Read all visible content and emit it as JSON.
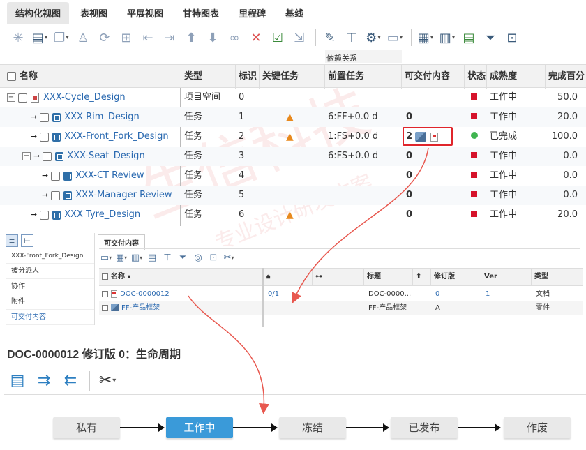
{
  "tabs": [
    {
      "label": "结构化视图",
      "active": true
    },
    {
      "label": "表视图"
    },
    {
      "label": "平展视图"
    },
    {
      "label": "甘特图表"
    },
    {
      "label": "里程碑"
    },
    {
      "label": "基线"
    }
  ],
  "grid": {
    "dependency_group": "依赖关系",
    "columns": [
      "名称",
      "类型",
      "标识",
      "关键任务",
      "前置任务",
      "可交付内容",
      "状态",
      "成熟度",
      "完成百分"
    ],
    "rows": [
      {
        "name": "XXX-Cycle_Design",
        "type": "项目空间",
        "id": "0",
        "critical": false,
        "pred": "",
        "deliverables": "",
        "status": "red",
        "maturity": "工作中",
        "percent": "50.0"
      },
      {
        "name": "XXX Rim_Design",
        "type": "任务",
        "id": "1",
        "critical": true,
        "pred": "6:FF+0.0 d",
        "deliverables": "0",
        "status": "red",
        "maturity": "工作中",
        "percent": "20.0"
      },
      {
        "name": "XXX-Front_Fork_Design",
        "type": "任务",
        "id": "2",
        "critical": true,
        "pred": "1:FS+0.0 d",
        "deliverables": "2",
        "status": "green",
        "maturity": "已完成",
        "percent": "100.0"
      },
      {
        "name": "XXX-Seat_Design",
        "type": "任务",
        "id": "3",
        "critical": false,
        "pred": "6:FS+0.0 d",
        "deliverables": "0",
        "status": "red",
        "maturity": "工作中",
        "percent": "0.0"
      },
      {
        "name": "XXX-CT Review",
        "type": "任务",
        "id": "4",
        "critical": false,
        "pred": "",
        "deliverables": "0",
        "status": "red",
        "maturity": "工作中",
        "percent": "0.0"
      },
      {
        "name": "XXX-Manager Review",
        "type": "任务",
        "id": "5",
        "critical": false,
        "pred": "",
        "deliverables": "0",
        "status": "red",
        "maturity": "工作中",
        "percent": "0.0"
      },
      {
        "name": "XXX Tyre_Design",
        "type": "任务",
        "id": "6",
        "critical": true,
        "pred": "",
        "deliverables": "0",
        "status": "red",
        "maturity": "工作中",
        "percent": "20.0"
      }
    ]
  },
  "detail": {
    "nav": {
      "items": [
        "XXX-Front_Fork_Design",
        "被分派人",
        "协作",
        "附件",
        "可交付内容"
      ]
    },
    "tab_label": "可交付内容",
    "columns": [
      "名称 ▴",
      "标题",
      "修订版",
      "Ver",
      "类型"
    ],
    "rows": [
      {
        "name": "DOC-0000012",
        "lock": "0/1",
        "title": "DOC-0000...",
        "rev": "0",
        "ver": "1",
        "type": "文档"
      },
      {
        "name": "FF-产品框架",
        "lock": "",
        "title": "FF-产品框架",
        "rev": "A",
        "ver": "",
        "type": "零件"
      }
    ]
  },
  "lifecycle": {
    "title": "DOC-0000012 修订版 0：生命周期",
    "states": [
      {
        "label": "私有"
      },
      {
        "label": "工作中",
        "current": true
      },
      {
        "label": "冻结"
      },
      {
        "label": "已发布"
      },
      {
        "label": "作废"
      }
    ]
  },
  "colors": {
    "accent": "#3a9ad9",
    "link": "#2a69b0",
    "highlight_box": "#e0252b",
    "status_red": "#d6132b",
    "status_green": "#3fb450",
    "warn": "#e8891d"
  }
}
